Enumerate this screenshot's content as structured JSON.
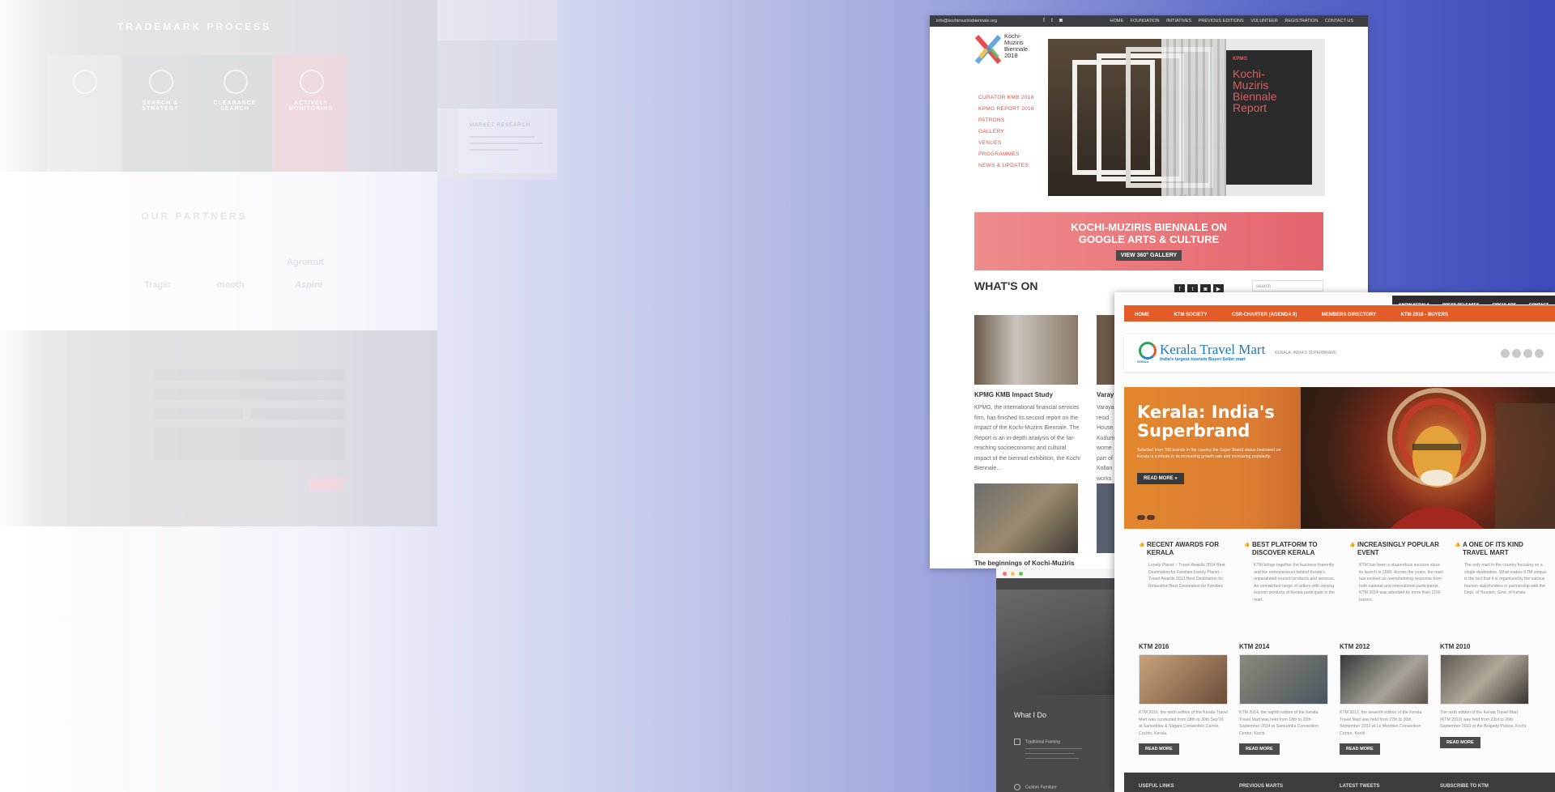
{
  "ghost": {
    "process_title": "TRADEMARK PROCESS",
    "process_cards": [
      "",
      "SEARCH & STRATEGY",
      "CLEARANCE SEARCH",
      "ACTIVELY MONITORING"
    ],
    "partners_title": "OUR PARTNERS",
    "partners": [
      "",
      "",
      "",
      "Agromut",
      "",
      "Tragic",
      "mooth",
      "Aspire"
    ],
    "side_card_title": "MARKET RESEARCH"
  },
  "kmb": {
    "email": "info@kochimuzirisbiennale.org",
    "nav": [
      "HOME",
      "FOUNDATION",
      "INITIATIVES",
      "PREVIOUS EDITIONS",
      "VOLUNTEER",
      "REGISTRATION",
      "CONTACT US"
    ],
    "logo_text": [
      "Kochi-",
      "Muziris",
      "Biennale",
      "2018"
    ],
    "menu": [
      "CURATOR KMB 2018",
      "KPMG REPORT 2016",
      "PATRONS",
      "GALLERY",
      "VENUES",
      "PROGRAMMES",
      "NEWS & UPDATES"
    ],
    "report_text": [
      "Kochi-",
      "Muziris",
      "Biennale",
      "Report"
    ],
    "banner_title_1": "KOCHI-MUZIRIS BIENNALE ON",
    "banner_title_2": "GOOGLE ARTS & CULTURE",
    "banner_button": "VIEW 360° GALLERY",
    "whats_on": "WHAT'S ON",
    "search_placeholder": "search",
    "posts": [
      {
        "title": "KPMG KMB Impact Study",
        "text": "KPMG, the international financial services firm, has finished its second report on the Impact of the Kochi-Muziris Biennale. The Report is an in-depth analysis of the far-reaching socioeconomic and cultural impact of the biennial exhibition, the Kochi Biennale..."
      },
      {
        "title": "Varay",
        "text": "Varaya resid House Kudum wome part of Kollan works"
      },
      {
        "title": "The beginnings of Kochi-Muziris",
        "text": ""
      }
    ]
  },
  "dark": {
    "heading": "What I Do",
    "items": [
      "Traditional Framing",
      "Custom Furniture"
    ]
  },
  "ktm": {
    "top_links": [
      "KNOW KERALA",
      "PRESS RELEASES",
      "CIRCULARS",
      "CONTACT"
    ],
    "nav": [
      "HOME",
      "KTM SOCIETY",
      "CSR-CHARTER (AGENDA 9)",
      "MEMBERS DIRECTORY",
      "KTM 2018 - BUYERS"
    ],
    "logo_title": "Kerala Travel Mart",
    "logo_sub": "India's largest tourism Buyer-Seller mart",
    "logo_mark_text": "KERALA",
    "tagline": "KERALA: INDIA'S SUPERBRAND",
    "hero_title_1": "Kerala: India's",
    "hero_title_2": "Superbrand",
    "hero_text": "Selected from 700 brands in the country the Super Brand status bestowed on Kerala is a tribute to its increasing growth rate and increasing popularity.",
    "hero_button": "READ MORE »",
    "features": [
      {
        "title": "RECENT AWARDS FOR KERALA",
        "text": "Lonely Planet – Travel Awards 2014 Best Destination for Families Lonely Planet – Travel Awards 2013 Best Destination for Relaxation Best Destination for Families"
      },
      {
        "title": "BEST PLATFORM TO DISCOVER KERALA",
        "text": "KTM brings together the business fraternity and the entrepreneurs behind Kerala's unparalleled tourism products and services. An unmatched range of sellers with varying tourism products of Kerala participate in the mart."
      },
      {
        "title": "INCREASINGLY POPULAR EVENT",
        "text": "KTM has been a stupendous success since its launch in 2000. Across the years, the mart has evoked an overwhelming response from both national and international participants. KTM 2014 was attended by more than 1100 buyers."
      },
      {
        "title": "A ONE OF ITS KIND TRAVEL MART",
        "text": "The only mart in the country focusing on a single destination. What makes KTM unique is the fact that it is organised by the various tourism stakeholders in partnership with the Dept. of Tourism, Govt. of Kerala."
      }
    ],
    "years": [
      {
        "title": "KTM 2016",
        "text": "KTM 2016, the ninth edition of the Kerala Travel Mart was conducted from 28th to 30th Sep'16 at Samudrika & Sagara Convention Centre, Cochin, Kerala.",
        "button": "READ MORE"
      },
      {
        "title": "KTM 2014",
        "text": "KTM 2014, the eighth edition of the Kerala Travel Mart was held from 18th to 20th September 2014 at Samudrika Convention Centre, Kochi.",
        "button": "READ MORE"
      },
      {
        "title": "KTM 2012",
        "text": "KTM 2012, the seventh edition of the Kerala Travel Mart was held from 27th to 30th September 2012 at Le Meridien Convention Centre, Kochi.",
        "button": "READ MORE"
      },
      {
        "title": "KTM 2010",
        "text": "The sixth edition of the Kerala Travel Mart (KTM 2010) was held from 23rd to 26th September 2010 at the Bolgatty Palace, Kochi.",
        "button": "READ MORE"
      }
    ],
    "footer": [
      "USEFUL LINKS",
      "PREVIOUS MARTS",
      "LATEST TWEETS",
      "SUBSCRIBE TO KTM"
    ]
  }
}
